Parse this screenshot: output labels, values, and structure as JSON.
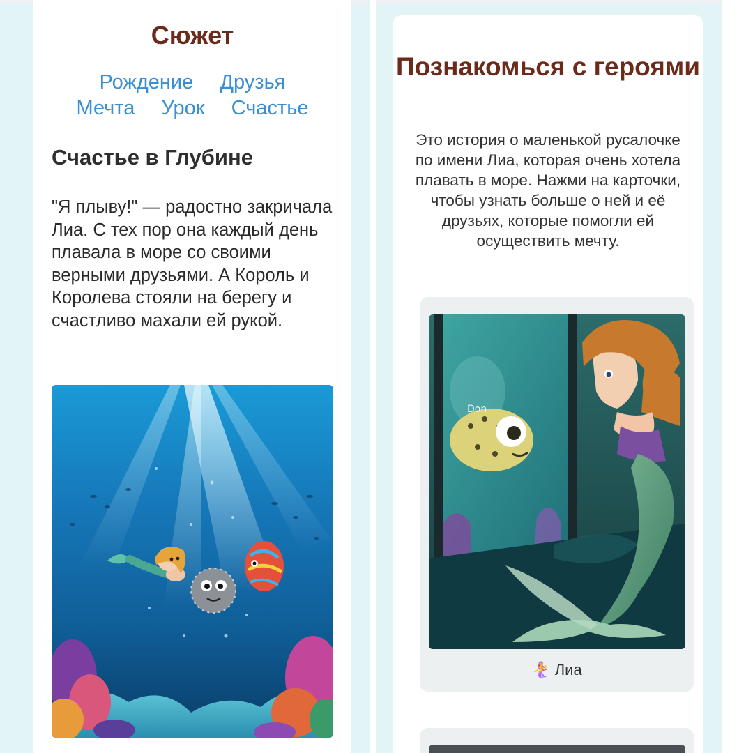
{
  "story": {
    "section_title": "Сюжет",
    "nav_rows": [
      [
        "Рождение",
        "Друзья"
      ],
      [
        "Мечта",
        "Урок",
        "Счастье"
      ]
    ],
    "chapter_title": "Счастье в Глубине",
    "chapter_text": "\"Я плыву!\" — радостно закричала Лиа. С тех пор она каждый день плавала в море со своими верными друзьями. А Король и Королева стояли на берегу и счастливо махали ей рукой."
  },
  "heroes": {
    "section_title": "Познакомься с героями",
    "intro": "Это история о маленькой русалочке по имени Лиа, которая очень хотела плавать в море. Нажми на карточки, чтобы узнать больше о ней и её друзьях, которые помогли ей осуществить мечту.",
    "cards": [
      {
        "name": "Лиа",
        "icon": "🧜‍♀️",
        "image_label": "Don"
      }
    ]
  },
  "colors": {
    "background": "#e3f4f6",
    "heading": "#6b2a1a",
    "link": "#3a8fd3",
    "card_bg": "#ecf0f1"
  }
}
